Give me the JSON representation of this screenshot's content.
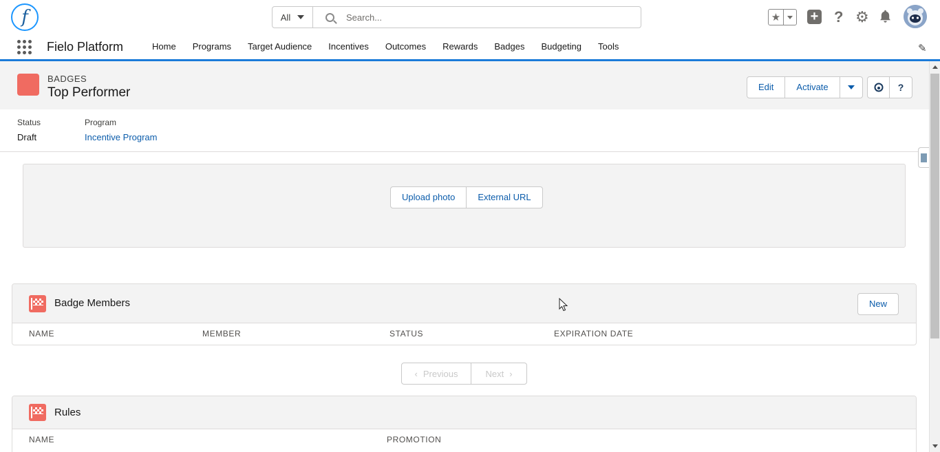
{
  "header": {
    "logo_letter": "f",
    "search_scope": "All",
    "search_placeholder": "Search..."
  },
  "nav": {
    "app_name": "Fielo Platform",
    "items": [
      "Home",
      "Programs",
      "Target Audience",
      "Incentives",
      "Outcomes",
      "Rewards",
      "Badges",
      "Budgeting",
      "Tools"
    ]
  },
  "record": {
    "object_type": "BADGES",
    "title": "Top Performer",
    "actions": {
      "edit": "Edit",
      "activate": "Activate"
    },
    "help_symbol": "?",
    "icon_color": "#f06b61"
  },
  "highlights": {
    "status_label": "Status",
    "status_value": "Draft",
    "program_label": "Program",
    "program_value": "Incentive Program"
  },
  "photo": {
    "upload_label": "Upload photo",
    "url_label": "External URL"
  },
  "badge_members": {
    "title": "Badge Members",
    "new_label": "New",
    "columns": [
      "NAME",
      "MEMBER",
      "STATUS",
      "EXPIRATION DATE"
    ]
  },
  "pager": {
    "previous": "Previous",
    "next": "Next"
  },
  "rules": {
    "title": "Rules",
    "columns": [
      "NAME",
      "PROMOTION"
    ]
  }
}
